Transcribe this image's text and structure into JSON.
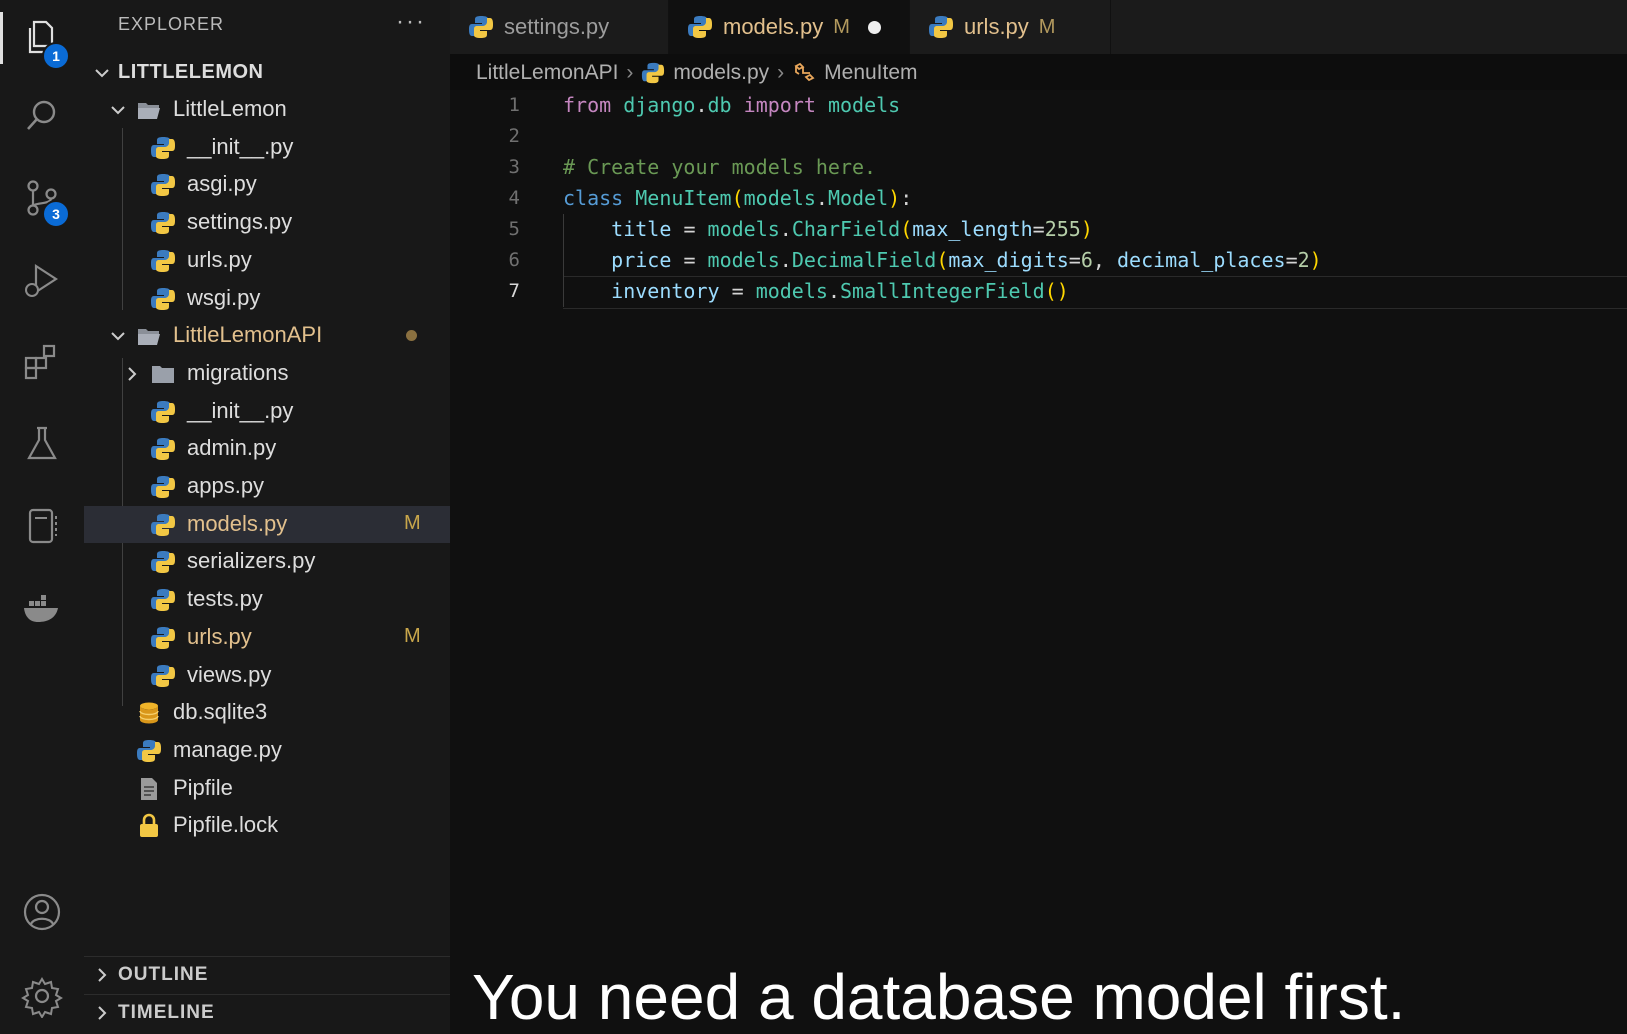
{
  "activity_bar": {
    "explorer_badge": "1",
    "source_control_badge": "3"
  },
  "sidebar": {
    "title": "EXPLORER",
    "more": "···",
    "root": "LITTLELEMON",
    "tree": [
      {
        "label": "LittleLemon",
        "kind": "folder-open",
        "git": ""
      },
      {
        "label": "__init__.py",
        "kind": "python",
        "git": ""
      },
      {
        "label": "asgi.py",
        "kind": "python",
        "git": ""
      },
      {
        "label": "settings.py",
        "kind": "python",
        "git": ""
      },
      {
        "label": "urls.py",
        "kind": "python",
        "git": ""
      },
      {
        "label": "wsgi.py",
        "kind": "python",
        "git": ""
      },
      {
        "label": "LittleLemonAPI",
        "kind": "folder-open",
        "git": ""
      },
      {
        "label": "migrations",
        "kind": "folder",
        "git": ""
      },
      {
        "label": "__init__.py",
        "kind": "python",
        "git": ""
      },
      {
        "label": "admin.py",
        "kind": "python",
        "git": ""
      },
      {
        "label": "apps.py",
        "kind": "python",
        "git": ""
      },
      {
        "label": "models.py",
        "kind": "python",
        "git": "M"
      },
      {
        "label": "serializers.py",
        "kind": "python",
        "git": ""
      },
      {
        "label": "tests.py",
        "kind": "python",
        "git": ""
      },
      {
        "label": "urls.py",
        "kind": "python",
        "git": "M"
      },
      {
        "label": "views.py",
        "kind": "python",
        "git": ""
      },
      {
        "label": "db.sqlite3",
        "kind": "database",
        "git": ""
      },
      {
        "label": "manage.py",
        "kind": "python",
        "git": ""
      },
      {
        "label": "Pipfile",
        "kind": "file",
        "git": ""
      },
      {
        "label": "Pipfile.lock",
        "kind": "lock",
        "git": ""
      }
    ],
    "outline": "OUTLINE",
    "timeline": "TIMELINE"
  },
  "tabs": [
    {
      "label": "settings.py",
      "mod": "",
      "active": false
    },
    {
      "label": "models.py",
      "mod": "M",
      "active": true
    },
    {
      "label": "urls.py",
      "mod": "M",
      "active": false
    }
  ],
  "breadcrumb": {
    "folder": "LittleLemonAPI",
    "file": "models.py",
    "symbol": "MenuItem"
  },
  "editor": {
    "line_numbers": [
      "1",
      "2",
      "3",
      "4",
      "5",
      "6",
      "7"
    ],
    "current_line": 7,
    "lines": [
      "from django.db import models",
      "",
      "# Create your models here.",
      "class MenuItem(models.Model):",
      "    title = models.CharField(max_length=255)",
      "    price = models.DecimalField(max_digits=6, decimal_places=2)",
      "    inventory = models.SmallIntegerField()"
    ]
  },
  "caption": "You need a database model first.",
  "colors": {
    "modified": "#e2c08d",
    "badge": "#0a6bd6",
    "background": "#0d0d0d"
  }
}
